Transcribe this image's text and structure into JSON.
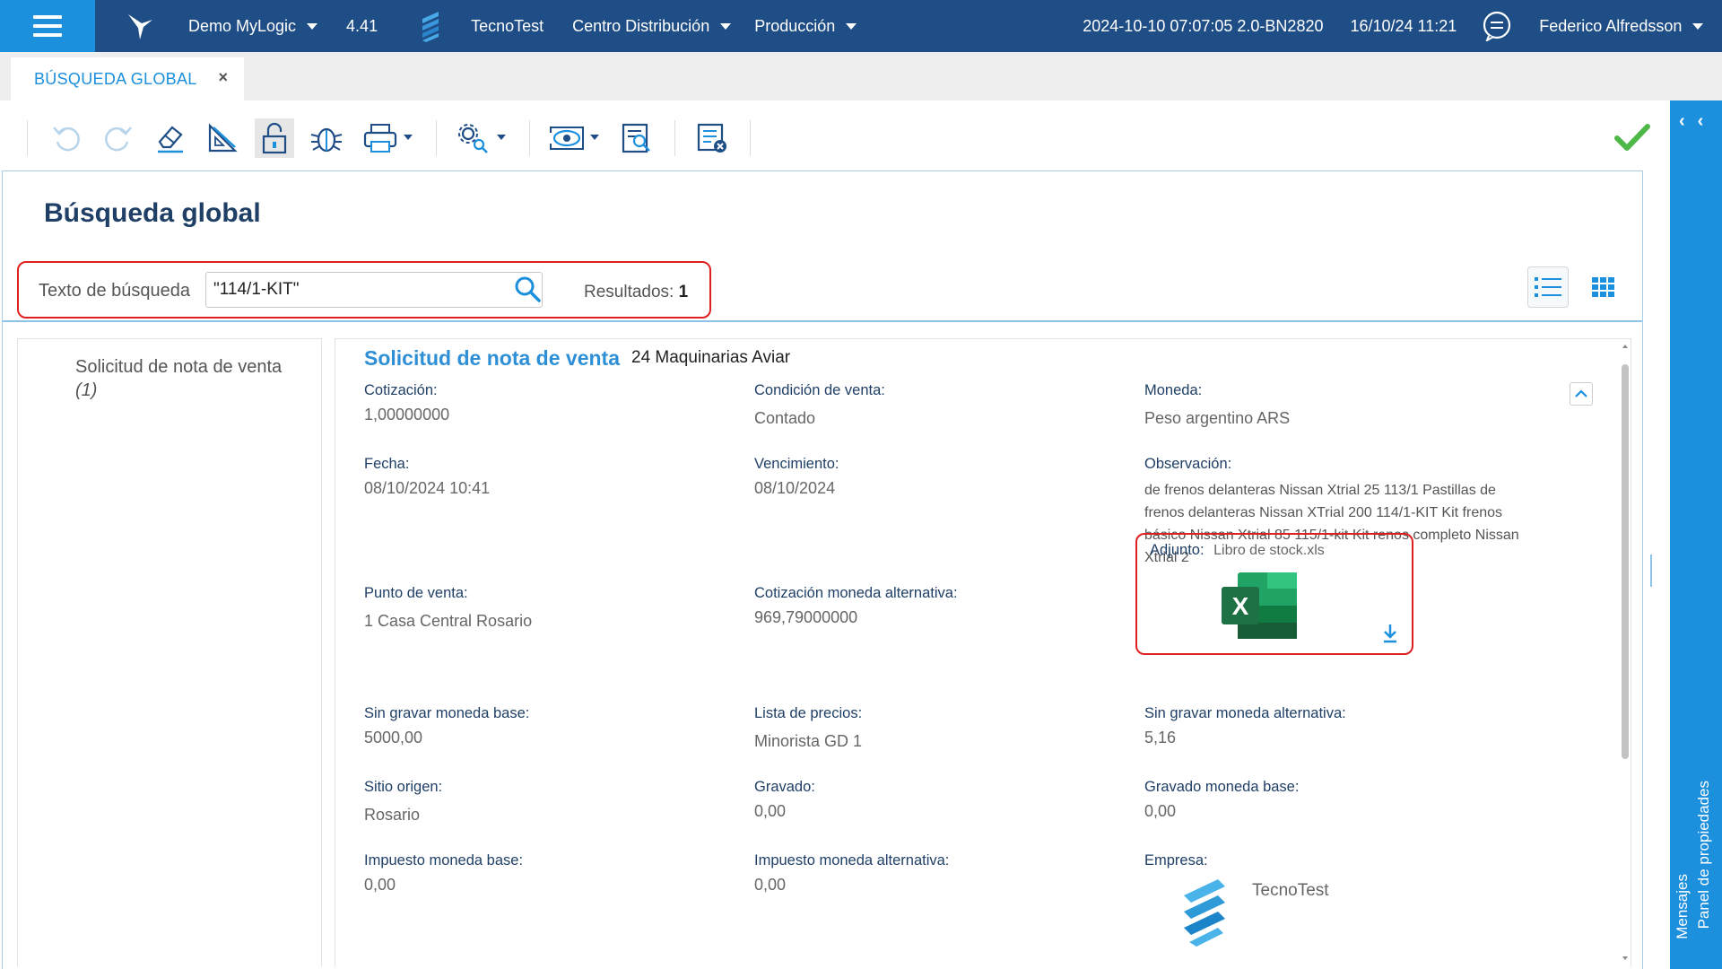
{
  "topbar": {
    "app_name": "Demo MyLogic",
    "version": "4.41",
    "company": "TecnoTest",
    "branch": "Centro Distribución",
    "environment": "Producción",
    "build": "2024-10-10 07:07:05 2.0-BN2820",
    "datetime": "16/10/24 11:21",
    "user": "Federico Alfredsson"
  },
  "tab": {
    "label": "BÚSQUEDA GLOBAL",
    "close": "×"
  },
  "page": {
    "title": "Búsqueda global"
  },
  "search": {
    "label": "Texto de búsqueda",
    "value": "\"114/1-KIT\"",
    "results_label": "Resultados:",
    "results_count": "1"
  },
  "sidebar": {
    "item_label": "Solicitud de nota de venta",
    "item_count": "(1)"
  },
  "record": {
    "title": "Solicitud de nota de venta",
    "subtitle": "24 Maquinarias Aviar",
    "fields": {
      "cotizacion": {
        "label": "Cotización:",
        "value": "1,00000000"
      },
      "condicion": {
        "label": "Condición de venta:",
        "value": "Contado"
      },
      "moneda": {
        "label": "Moneda:",
        "value": "Peso argentino ARS"
      },
      "fecha": {
        "label": "Fecha:",
        "value": "08/10/2024 10:41"
      },
      "vencimiento": {
        "label": "Vencimiento:",
        "value": "08/10/2024"
      },
      "observacion": {
        "label": "Observación:",
        "value": "de frenos delanteras Nissan Xtrial 25 113/1 Pastillas de frenos delanteras Nissan XTrial 200 114/1-KIT Kit frenos básico Nissan Xtrial 85 115/1-kit Kit renos completo Nissan Xtrial 2"
      },
      "punto_venta": {
        "label": "Punto de venta:",
        "value": "1 Casa Central Rosario"
      },
      "cot_alt": {
        "label": "Cotización moneda alternativa:",
        "value": "969,79000000"
      },
      "adjunto": {
        "label": "Adjunto:",
        "value": "Libro de stock.xls"
      },
      "sin_gravar_base": {
        "label": "Sin gravar moneda base:",
        "value": "5000,00"
      },
      "lista_precios": {
        "label": "Lista de precios:",
        "value": "Minorista GD 1"
      },
      "sin_gravar_alt": {
        "label": "Sin gravar moneda alternativa:",
        "value": "5,16"
      },
      "sitio_origen": {
        "label": "Sitio origen:",
        "value": "Rosario"
      },
      "gravado": {
        "label": "Gravado:",
        "value": "0,00"
      },
      "gravado_base": {
        "label": "Gravado moneda base:",
        "value": "0,00"
      },
      "impuesto_base": {
        "label": "Impuesto moneda base:",
        "value": "0,00"
      },
      "impuesto_alt": {
        "label": "Impuesto moneda alternativa:",
        "value": "0,00"
      },
      "empresa": {
        "label": "Empresa:",
        "value": "TecnoTest"
      }
    }
  },
  "right_panel": {
    "properties": "Panel de propiedades",
    "messages": "Mensajes"
  },
  "icons": {
    "excel_letter": "X",
    "toolbar": [
      "undo-icon",
      "redo-icon",
      "eraser-icon",
      "ruler-icon",
      "unlock-icon",
      "bug-icon",
      "print-icon",
      "settings-search-icon",
      "eye-icon",
      "document-search-icon",
      "list-clear-icon",
      "check-icon"
    ]
  },
  "colors": {
    "primary": "#1f4e86",
    "accent": "#1c8fdd",
    "highlight": "#e02020",
    "success": "#4db848",
    "excel": "#1e7145"
  }
}
